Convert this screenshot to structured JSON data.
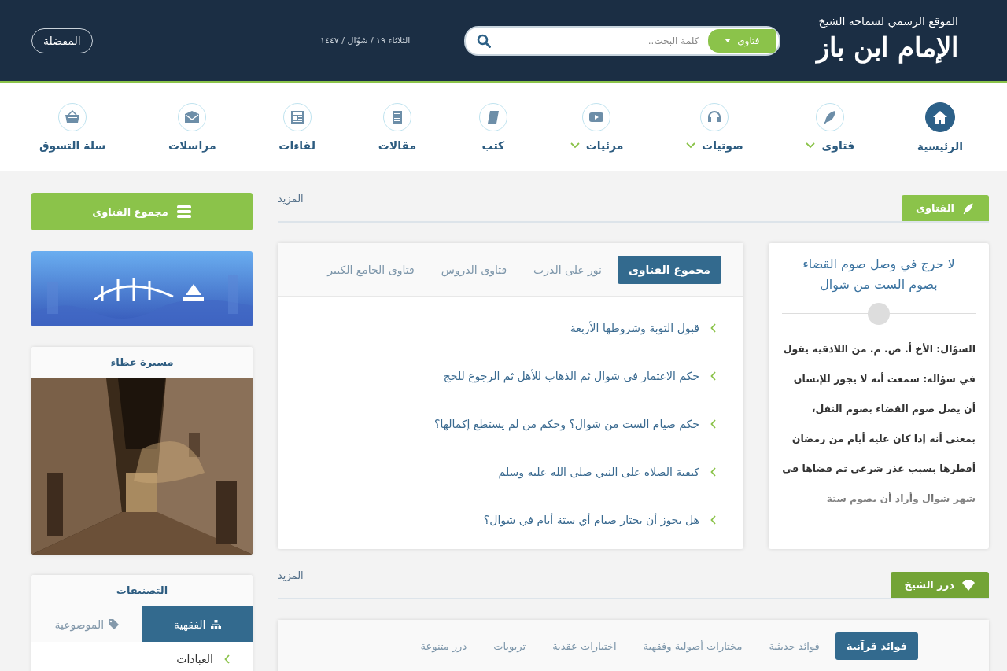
{
  "header": {
    "site_tagline": "الموقع الرسمي لسماحة الشيخ",
    "logo_text": "الإمام ابن باز",
    "search": {
      "scope": "فتاوى",
      "placeholder": "كلمة البحث.."
    },
    "date": "الثلاثاء ١٩ / شوّال / ١٤٤٧",
    "favorites_button": "المفضلة"
  },
  "nav": [
    {
      "label": "الرئيسية",
      "selected": true,
      "dropdown": false
    },
    {
      "label": "فتاوى",
      "selected": false,
      "dropdown": true
    },
    {
      "label": "صوتيات",
      "selected": false,
      "dropdown": true
    },
    {
      "label": "مرئيات",
      "selected": false,
      "dropdown": true
    },
    {
      "label": "كتب",
      "selected": false,
      "dropdown": false
    },
    {
      "label": "مقالات",
      "selected": false,
      "dropdown": false
    },
    {
      "label": "لقاءات",
      "selected": false,
      "dropdown": false
    },
    {
      "label": "مراسلات",
      "selected": false,
      "dropdown": false
    },
    {
      "label": "سلة التسوق",
      "selected": false,
      "dropdown": false
    }
  ],
  "fatawa_section": {
    "title": "الفتاوى",
    "more": "المزيد",
    "featured": {
      "title": "لا حرج في وصل صوم القضاء بصوم الست من شوال",
      "body": "السؤال: الأخ أ. ص. م. من اللاذقية يقول في سؤاله: سمعت أنه لا يجوز للإنسان أن يصل صوم القضاء بصوم النفل، بمعنى أنه إذا كان عليه أيام من رمضان أفطرها بسبب عذر شرعي ثم قضاها في شهر شوال وأراد أن يصوم ستة"
    },
    "tabs": [
      {
        "label": "مجموع الفتاوى",
        "selected": true
      },
      {
        "label": "نور على الدرب",
        "selected": false
      },
      {
        "label": "فتاوى الدروس",
        "selected": false
      },
      {
        "label": "فتاوى الجامع الكبير",
        "selected": false
      }
    ],
    "items": [
      "قبول التوبة وشروطها الأربعة",
      "حكم الاعتمار في شوال ثم الذهاب للأهل ثم الرجوع للحج",
      "حكم صيام الست من شوال؟ وحكم من لم يستطع إكمالها؟",
      "كيفية الصلاة على النبي صلى الله عليه وسلم",
      "هل يجوز أن يختار صيام أي ستة أيام في شوال؟"
    ]
  },
  "durar_section": {
    "title": "درر الشيخ",
    "more": "المزيد",
    "tabs": [
      {
        "label": "فوائد قرآنية",
        "selected": true
      },
      {
        "label": "فوائد حديثية",
        "selected": false
      },
      {
        "label": "مختارات أصولية وفقهية",
        "selected": false
      },
      {
        "label": "اختيارات عقدية",
        "selected": false
      },
      {
        "label": "تربويات",
        "selected": false
      },
      {
        "label": "درر متنوعة",
        "selected": false
      }
    ]
  },
  "sidebar": {
    "fatawa_button": "مجموع الفتاوى",
    "journey_card": {
      "title": "مسيرة عطاء"
    },
    "categories": {
      "title": "التصنيفات",
      "tabs": [
        {
          "label": "الفقهية",
          "selected": true
        },
        {
          "label": "الموضوعية",
          "selected": false
        }
      ],
      "items": [
        "العبادات"
      ]
    }
  }
}
